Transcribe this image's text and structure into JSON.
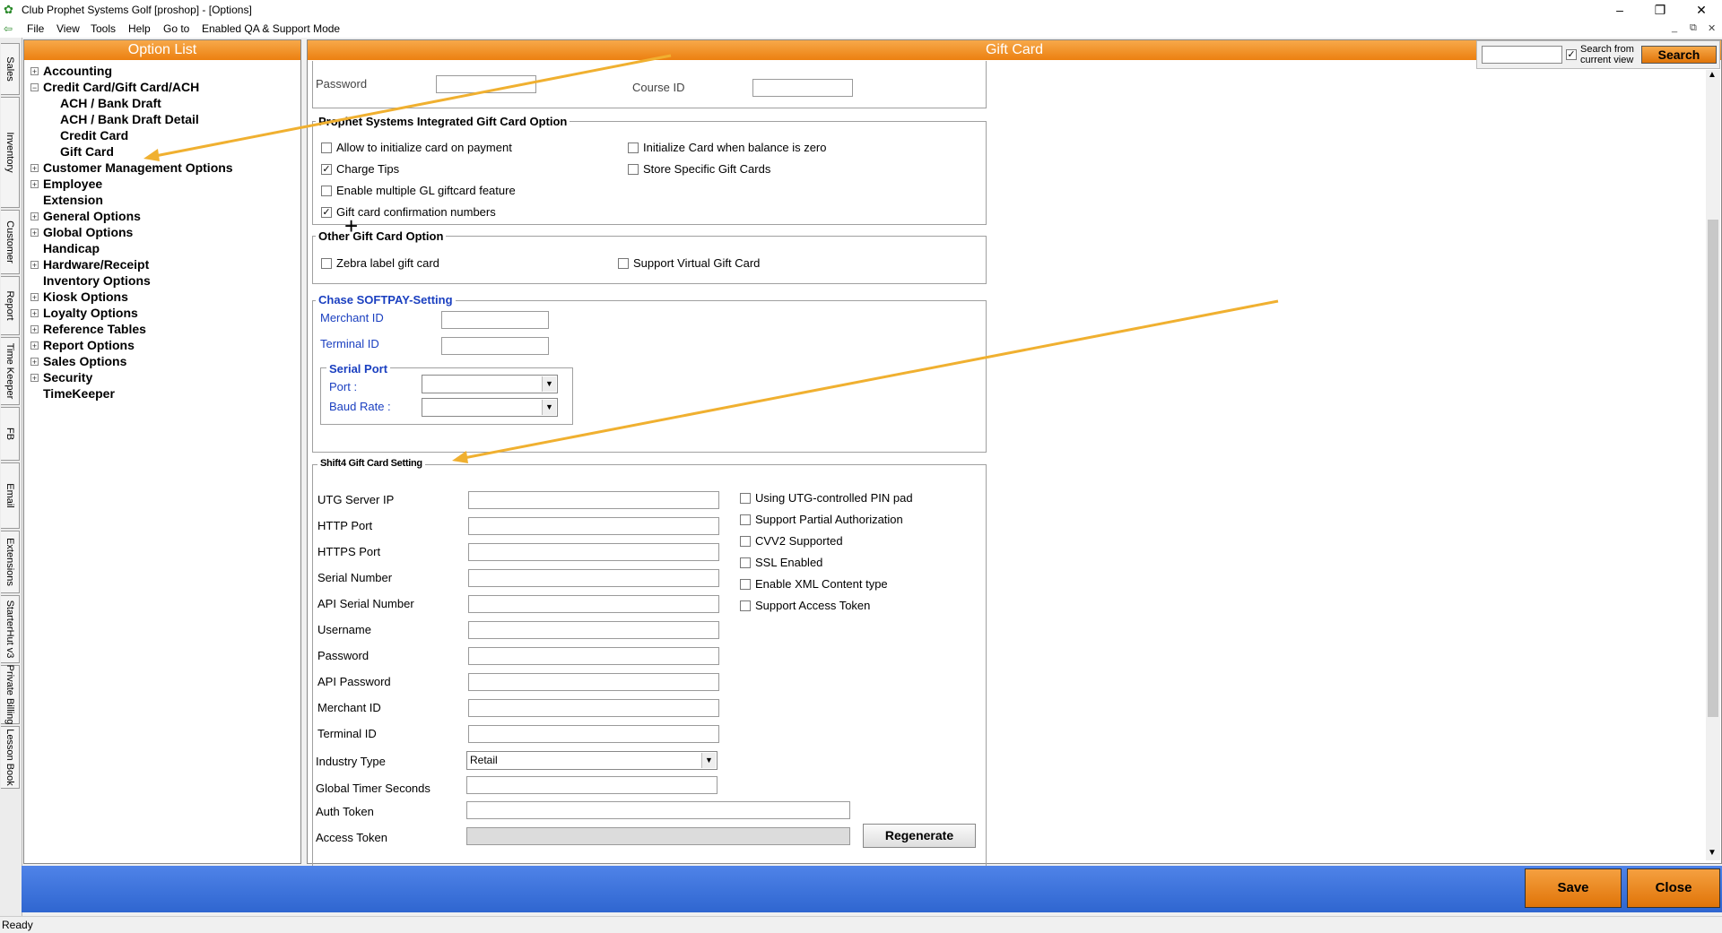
{
  "window": {
    "title": "Club Prophet Systems Golf [proshop] - [Options]",
    "minimize": "–",
    "restore": "❐",
    "close": "✕",
    "mdi_minimize": "_",
    "mdi_restore": "⧉",
    "mdi_close": "✕"
  },
  "menu": [
    "File",
    "View",
    "Tools",
    "Help",
    "Go to",
    "Enabled QA & Support Mode"
  ],
  "side_tabs": [
    "Sales",
    "Inventory",
    "Customer",
    "Report",
    "Time Keeper",
    "FB",
    "Email",
    "Extensions",
    "StarterHut v3",
    "Private Billing",
    "Lesson Book"
  ],
  "option_list": {
    "header": "Option List",
    "items": [
      {
        "label": "Accounting",
        "expander": "+"
      },
      {
        "label": "Credit Card/Gift Card/ACH",
        "expander": "−"
      },
      {
        "label": "ACH / Bank Draft",
        "expander": ""
      },
      {
        "label": "ACH / Bank Draft Detail",
        "expander": ""
      },
      {
        "label": "Credit Card",
        "expander": ""
      },
      {
        "label": "Gift Card",
        "expander": ""
      },
      {
        "label": "Customer Management Options",
        "expander": "+"
      },
      {
        "label": "Employee",
        "expander": "+"
      },
      {
        "label": "Extension",
        "expander": ""
      },
      {
        "label": "General Options",
        "expander": "+"
      },
      {
        "label": "Global Options",
        "expander": "+"
      },
      {
        "label": "Handicap",
        "expander": ""
      },
      {
        "label": "Hardware/Receipt",
        "expander": "+"
      },
      {
        "label": "Inventory Options",
        "expander": ""
      },
      {
        "label": "Kiosk Options",
        "expander": "+"
      },
      {
        "label": "Loyalty Options",
        "expander": "+"
      },
      {
        "label": "Reference Tables",
        "expander": "+"
      },
      {
        "label": "Report Options",
        "expander": "+"
      },
      {
        "label": "Sales Options",
        "expander": "+"
      },
      {
        "label": "Security",
        "expander": "+"
      },
      {
        "label": "TimeKeeper",
        "expander": ""
      }
    ]
  },
  "main": {
    "header": "Gift Card",
    "search": {
      "label_line1": "Search from",
      "label_line2": "current view",
      "button": "Search",
      "value": "",
      "checked": "✓"
    },
    "top_group": {
      "password_label": "Password",
      "course_id_label": "Course ID"
    },
    "integrated": {
      "title": "Prophet Systems Integrated Gift Card Option",
      "options": [
        {
          "label": "Allow to initialize card on payment",
          "check": ""
        },
        {
          "label": "Charge Tips",
          "check": "✓"
        },
        {
          "label": "Enable multiple GL giftcard feature",
          "check": ""
        },
        {
          "label": "Gift card confirmation numbers",
          "check": "✓"
        },
        {
          "label": "Initialize Card when balance is zero",
          "check": ""
        },
        {
          "label": "Store Specific Gift Cards",
          "check": ""
        }
      ]
    },
    "other": {
      "title": "Other Gift Card Option",
      "options": [
        {
          "label": "Zebra label gift card",
          "check": ""
        },
        {
          "label": "Support Virtual Gift Card",
          "check": ""
        }
      ]
    },
    "chase": {
      "title": "Chase SOFTPAY-Setting",
      "merchant_id": "Merchant ID",
      "terminal_id": "Terminal ID",
      "serial_port_title": "Serial Port",
      "port_label": "Port :",
      "baud_label": "Baud Rate :"
    },
    "shift4": {
      "title": "Shift4 Gift Card Setting",
      "fields": [
        "UTG Server IP",
        "HTTP Port",
        "HTTPS Port",
        "Serial Number",
        "API Serial Number",
        "Username",
        "Password",
        "API Password",
        "Merchant ID",
        "Terminal ID"
      ],
      "industry_label": "Industry Type",
      "industry_value": "Retail",
      "timer_label": "Global Timer Seconds",
      "auth_label": "Auth Token",
      "access_label": "Access Token",
      "regenerate": "Regenerate",
      "options": [
        {
          "label": "Using UTG-controlled PIN pad",
          "check": ""
        },
        {
          "label": "Support Partial Authorization",
          "check": ""
        },
        {
          "label": "CVV2 Supported",
          "check": ""
        },
        {
          "label": "SSL Enabled",
          "check": ""
        },
        {
          "label": "Enable XML Content type",
          "check": ""
        },
        {
          "label": "Support Access Token",
          "check": ""
        }
      ]
    }
  },
  "footer": {
    "save": "Save",
    "close": "Close"
  },
  "status": "Ready",
  "annotation_color": "#f0b030"
}
